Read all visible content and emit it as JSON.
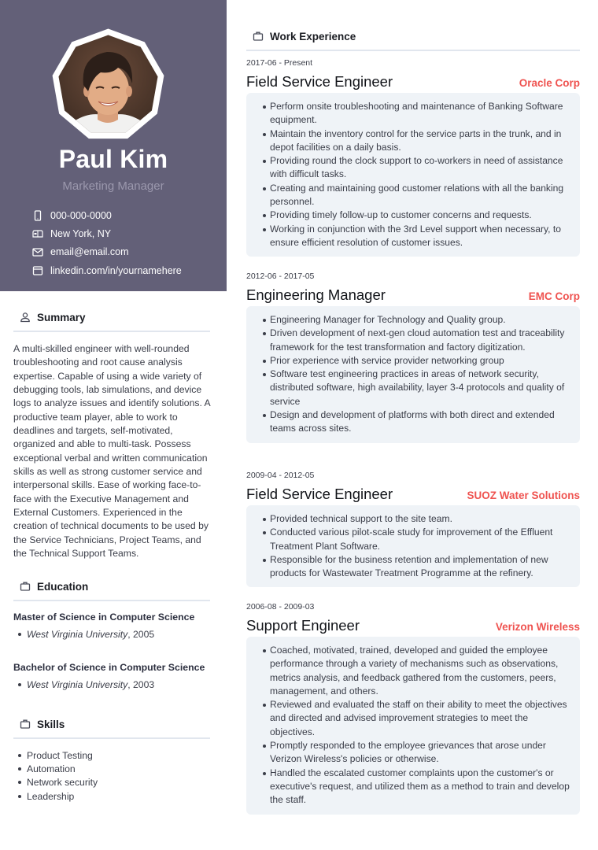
{
  "profile": {
    "name": "Paul Kim",
    "role": "Marketing Manager",
    "photo_alt": "Profile photo",
    "contacts": [
      {
        "icon": "phone-icon",
        "text": "000-000-0000"
      },
      {
        "icon": "mailbox-icon",
        "text": "New York, NY"
      },
      {
        "icon": "envelope-icon",
        "text": "email@email.com"
      },
      {
        "icon": "browser-window-icon",
        "text": "linkedin.com/in/yournamehere"
      }
    ]
  },
  "summary": {
    "title": "Summary",
    "icon": "user-icon",
    "text": "A multi-skilled engineer with well-rounded troubleshooting and root cause analysis expertise. Capable of using a wide variety of debugging tools, lab simulations, and device logs to analyze issues and identify solutions. A productive team player, able to work to deadlines and targets, self-motivated, organized and able to multi-task. Possess exceptional verbal and written communication skills as well as strong customer service and interpersonal skills. Ease of working face-to-face with the Executive Management and External Customers. Experienced in the creation of technical documents to be used by the Service Technicians, Project Teams, and the Technical Support Teams."
  },
  "education": {
    "title": "Education",
    "icon": "briefcase-icon",
    "items": [
      {
        "degree": "Master of Science in Computer Science",
        "institution": "West Virginia University",
        "year": ", 2005"
      },
      {
        "degree": "Bachelor of Science in Computer Science",
        "institution": "West Virginia University",
        "year": ", 2003"
      }
    ]
  },
  "skills": {
    "title": "Skills",
    "icon": "briefcase-icon",
    "items": [
      "Product Testing",
      "Automation",
      "Network security",
      "Leadership"
    ]
  },
  "work": {
    "title": "Work Experience",
    "icon": "briefcase-icon",
    "accent_color": "#ef5350",
    "jobs": [
      {
        "dates": "2017-06 - Present",
        "title": "Field Service Engineer",
        "company": "Oracle Corp",
        "bullets": [
          "Perform onsite troubleshooting and maintenance of Banking Software equipment.",
          "Maintain the inventory control for the service parts in the trunk, and in depot facilities on a daily basis.",
          "Providing round the clock support to co-workers in need of assistance with difficult tasks.",
          "Creating and maintaining good customer relations with all the banking personnel.",
          "Providing timely follow-up to customer concerns and requests.",
          "Working in conjunction with the 3rd Level support when necessary, to ensure efficient resolution of customer issues."
        ]
      },
      {
        "dates": "2012-06 - 2017-05",
        "title": "Engineering Manager",
        "company": "EMC Corp",
        "bullets": [
          "Engineering Manager for Technology and Quality group.",
          "Driven development of next-gen cloud automation test and traceability framework for the test transformation and factory digitization.",
          "Prior experience with service provider networking group",
          "Software test engineering practices in areas of network security, distributed software, high availability, layer 3-4 protocols and quality of service",
          "Design and development of platforms with both direct and extended teams across sites."
        ]
      },
      {
        "dates": "2009-04 - 2012-05",
        "title": "Field Service Engineer",
        "company": "SUOZ Water Solutions",
        "bullets": [
          "Provided technical support to the site team.",
          "Conducted various pilot-scale study for improvement of the Effluent Treatment Plant Software.",
          "Responsible for the business retention and implementation of new products for Wastewater Treatment Programme at the refinery."
        ]
      },
      {
        "dates": "2006-08 - 2009-03",
        "title": "Support Engineer",
        "company": "Verizon Wireless",
        "bullets": [
          "Coached, motivated, trained, developed and guided the employee performance through a variety of mechanisms such as observations, metrics analysis, and feedback gathered from the customers, peers, management, and others.",
          "Reviewed and evaluated the staff on their ability to meet the objectives and directed and advised improvement strategies to meet the objectives.",
          "Promptly responded to the employee grievances that arose under Verizon Wireless's policies or otherwise.",
          "Handled the escalated customer complaints upon the customer's or executive's request, and utilized them as a method to train and develop the staff."
        ]
      }
    ]
  }
}
